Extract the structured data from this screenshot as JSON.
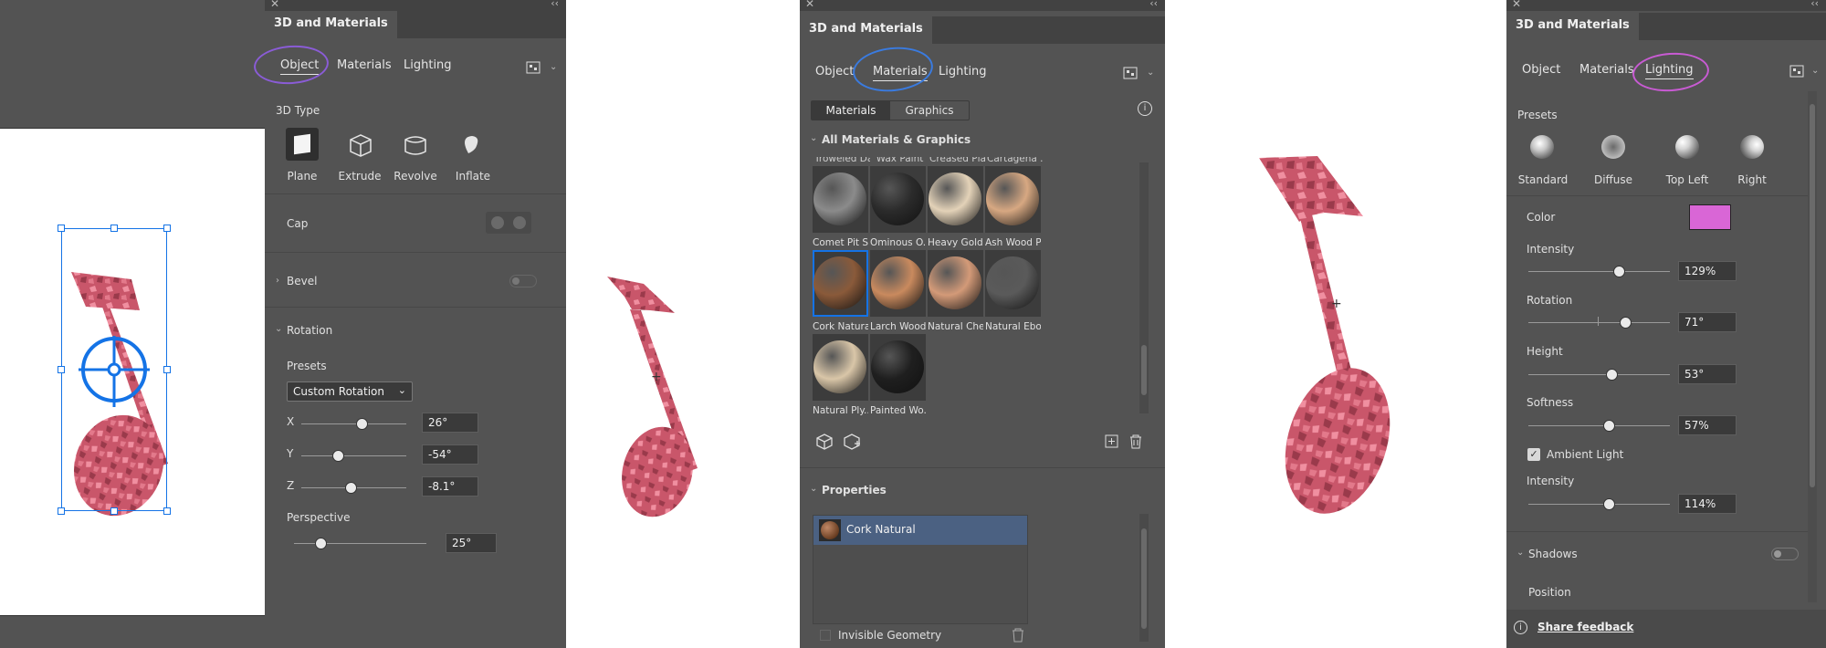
{
  "panel1": {
    "header": "3D and Materials",
    "tabs": [
      "Object",
      "Materials",
      "Lighting"
    ],
    "active_tab": "Object",
    "section_3d_type": "3D Type",
    "types": [
      "Plane",
      "Extrude",
      "Revolve",
      "Inflate"
    ],
    "selected_type": "Plane",
    "cap_label": "Cap",
    "bevel_label": "Bevel",
    "rotation_label": "Rotation",
    "presets_label": "Presets",
    "preset_value": "Custom Rotation",
    "x_label": "X",
    "x_value": "26°",
    "x_pos": 0.58,
    "y_label": "Y",
    "y_value": "-54°",
    "y_pos": 0.35,
    "z_label": "Z",
    "z_value": "-8.1°",
    "z_pos": 0.47,
    "perspective_label": "Perspective",
    "perspective_value": "25°",
    "perspective_pos": 0.2
  },
  "panel2": {
    "header": "3D and Materials",
    "tabs": [
      "Object",
      "Materials",
      "Lighting"
    ],
    "active_tab": "Materials",
    "subtabs": [
      "Materials",
      "Graphics"
    ],
    "active_subtab": "Materials",
    "section_all": "All Materials & Graphics",
    "top_row_partial": [
      "Troweled Da...",
      "Wax Paint",
      "Creased Plas...",
      "Cartagena ..."
    ],
    "materials": [
      {
        "name": "Comet Pit Su...",
        "color": "#8b8b8b"
      },
      {
        "name": "Ominous O...",
        "color": "#2b2b2b"
      },
      {
        "name": "Heavy Gold...",
        "color": "#e3d2b8"
      },
      {
        "name": "Ash Wood P...",
        "color": "#d7a882"
      },
      {
        "name": "Cork Natural",
        "color": "#8a5a3a"
      },
      {
        "name": "Larch Wood...",
        "color": "#c98a5e"
      },
      {
        "name": "Natural Che...",
        "color": "#d39a78"
      },
      {
        "name": "Natural Ebo...",
        "color": "#5a5a5a"
      },
      {
        "name": "Natural Ply...",
        "color": "#d9c6a8"
      },
      {
        "name": "Painted Wo...",
        "color": "#1f1f1f"
      }
    ],
    "selected_material": "Cork Natural",
    "properties_label": "Properties",
    "properties_item": "Cork Natural",
    "invisible_geometry_label": "Invisible Geometry"
  },
  "panel3": {
    "header": "3D and Materials",
    "tabs": [
      "Object",
      "Materials",
      "Lighting"
    ],
    "active_tab": "Lighting",
    "presets_label": "Presets",
    "presets": [
      "Standard",
      "Diffuse",
      "Top Left",
      "Right"
    ],
    "color_label": "Color",
    "light_color": "#d966d6",
    "intensity_label": "Intensity",
    "intensity_value": "129%",
    "intensity_pos": 0.64,
    "rotation_label": "Rotation",
    "rotation_value": "71°",
    "rotation_pos": 0.69,
    "height_label": "Height",
    "height_value": "53°",
    "height_pos": 0.59,
    "softness_label": "Softness",
    "softness_value": "57%",
    "softness_pos": 0.57,
    "ambient_label": "Ambient Light",
    "ambient_checked": true,
    "ambient_intensity_label": "Intensity",
    "ambient_intensity_value": "114%",
    "ambient_intensity_pos": 0.57,
    "shadows_label": "Shadows",
    "position_label": "Position",
    "feedback_label": "Share feedback"
  },
  "colors": {
    "panel_bg": "#535353",
    "selection_blue": "#1473e6",
    "rose_note": "#cf5d6e",
    "annotation_purple": "#8a5cd6",
    "annotation_blue": "#3a7be0",
    "annotation_pink": "#c85bd3"
  }
}
